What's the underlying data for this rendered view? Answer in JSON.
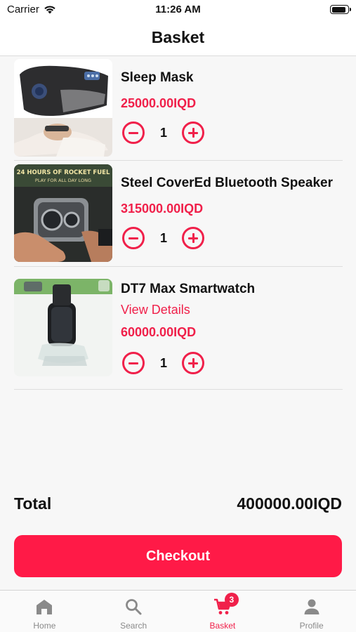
{
  "status": {
    "carrier": "Carrier",
    "time": "11:26 AM"
  },
  "header": {
    "title": "Basket"
  },
  "items": [
    {
      "name": "Sleep Mask",
      "price": "25000.00IQD",
      "quantity": "1"
    },
    {
      "name": "Steel CoverEd Bluetooth Speaker",
      "price": "315000.00IQD",
      "quantity": "1",
      "image_text": [
        "24 HOURS OF ROCKET FUEL",
        "PLAY FOR ALL DAY LONG"
      ]
    },
    {
      "name": "DT7 Max Smartwatch",
      "link": "View Details",
      "price": "60000.00IQD",
      "quantity": "1"
    }
  ],
  "total": {
    "label": "Total",
    "value": "400000.00IQD"
  },
  "checkout": {
    "label": "Checkout"
  },
  "tabs": [
    {
      "label": "Home",
      "icon": "home-icon",
      "active": false
    },
    {
      "label": "Search",
      "icon": "search-icon",
      "active": false
    },
    {
      "label": "Basket",
      "icon": "cart-icon",
      "active": true,
      "badge": "3"
    },
    {
      "label": "Profile",
      "icon": "person-icon",
      "active": false
    }
  ],
  "colors": {
    "accent": "#f0204a",
    "checkout": "#ff1a47",
    "inactive_tab": "#8a8a8a"
  }
}
